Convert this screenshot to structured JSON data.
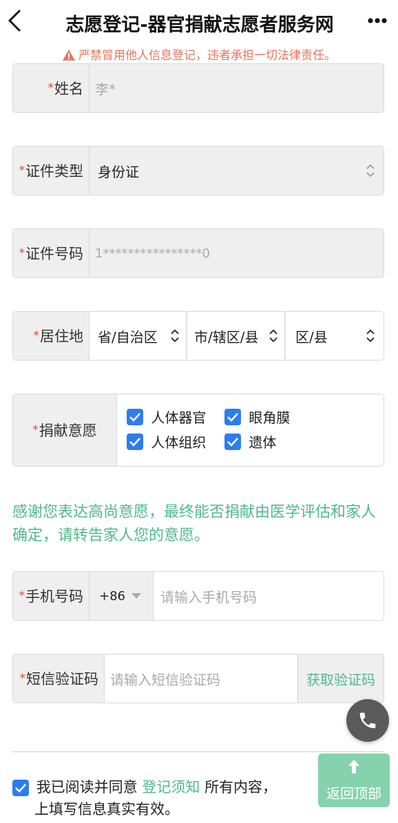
{
  "header": {
    "title": "志愿登记-器官捐献志愿者服务网"
  },
  "warning_text": "严禁冒用他人信息登记，违者承担一切法律责任。",
  "form": {
    "required_mark": "*",
    "name": {
      "label": "姓名",
      "value": "李*"
    },
    "id_type": {
      "label": "证件类型",
      "value": "身份证"
    },
    "id_number": {
      "label": "证件号码",
      "value": "1****************0"
    },
    "residence": {
      "label": "居住地",
      "province": "省/自治区",
      "city": "市/辖区/县",
      "district": "区/县"
    },
    "donation": {
      "label": "捐献意愿",
      "options": [
        {
          "label": "人体器官",
          "checked": true
        },
        {
          "label": "眼角膜",
          "checked": true
        },
        {
          "label": "人体组织",
          "checked": true
        },
        {
          "label": "遗体",
          "checked": true
        }
      ]
    },
    "phone": {
      "label": "手机号码",
      "country_code": "+86",
      "placeholder": "请输入手机号码"
    },
    "sms": {
      "label": "短信验证码",
      "placeholder": "请输入短信验证码",
      "button": "获取验证码"
    }
  },
  "notice_text": "感谢您表达高尚意愿，最终能否捐献由医学评估和家人确定，请转告家人您的意愿。",
  "agreement": {
    "checked": true,
    "prefix": "我已阅读并同意",
    "link": "登记须知",
    "suffix": "所有内容，",
    "line2": "上填写信息真实有效。"
  },
  "back_to_top_label": "返回顶部",
  "colors": {
    "accent_green": "#4fb98c",
    "checkbox_blue": "#2d7df0",
    "warning": "#e8745d",
    "required": "#e04a2f"
  }
}
